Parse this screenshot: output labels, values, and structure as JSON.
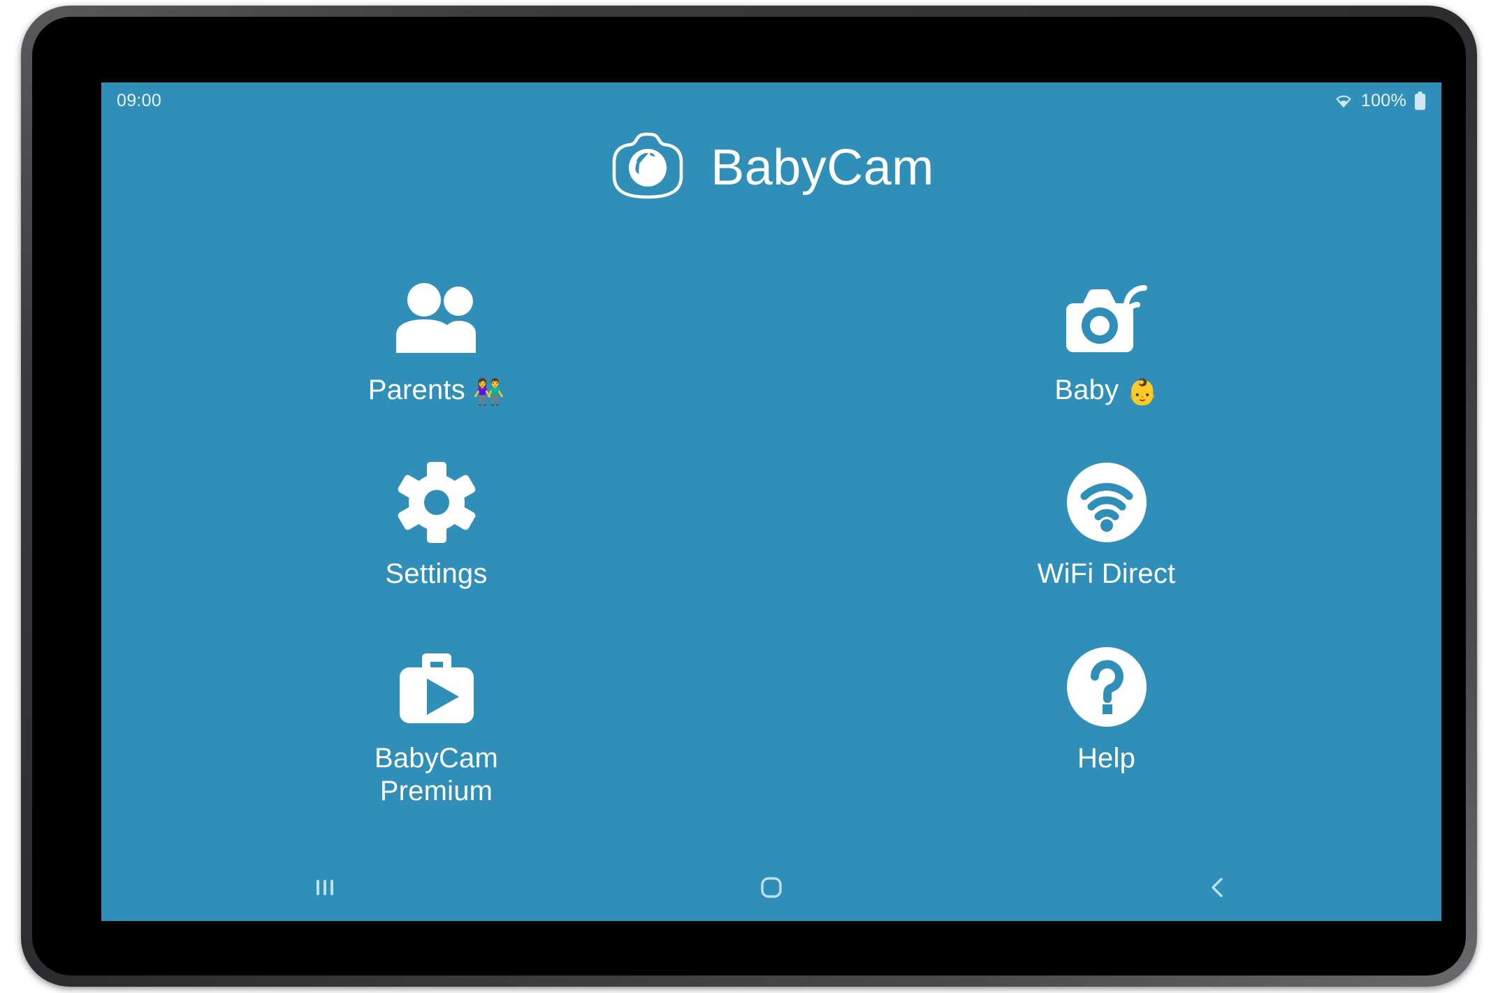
{
  "device": {
    "type": "tablet",
    "frame_color": "#3b3b3d",
    "bezel_color": "#000000"
  },
  "theme": {
    "background": "#2f8fb8",
    "foreground": "#ffffff",
    "status_text": "#e8f4fa"
  },
  "status_bar": {
    "clock": "09:00",
    "battery_percent": "100%",
    "wifi_icon": "wifi-icon",
    "battery_icon": "battery-full-icon"
  },
  "header": {
    "title": "BabyCam",
    "logo_icon": "babycam-logo-icon"
  },
  "menu": {
    "items": [
      {
        "id": "parents",
        "label": "Parents ",
        "emoji": "👫",
        "icon": "two-people-icon",
        "column": "left",
        "row": 1
      },
      {
        "id": "baby",
        "label": "Baby ",
        "emoji": "👶",
        "icon": "camera-streaming-icon",
        "column": "right",
        "row": 1
      },
      {
        "id": "settings",
        "label": "Settings",
        "emoji": "",
        "icon": "gear-icon",
        "column": "left",
        "row": 2
      },
      {
        "id": "wifi-direct",
        "label": "WiFi Direct",
        "emoji": "",
        "icon": "wifi-circle-icon",
        "column": "right",
        "row": 2
      },
      {
        "id": "babycam-premium",
        "label": "BabyCam\nPremium",
        "emoji": "",
        "icon": "briefcase-play-icon",
        "column": "left",
        "row": 3
      },
      {
        "id": "help",
        "label": "Help",
        "emoji": "",
        "icon": "question-circle-icon",
        "column": "right",
        "row": 3
      }
    ]
  },
  "nav_bar": {
    "recents_icon": "recents-icon",
    "home_icon": "home-icon",
    "back_icon": "back-icon"
  }
}
